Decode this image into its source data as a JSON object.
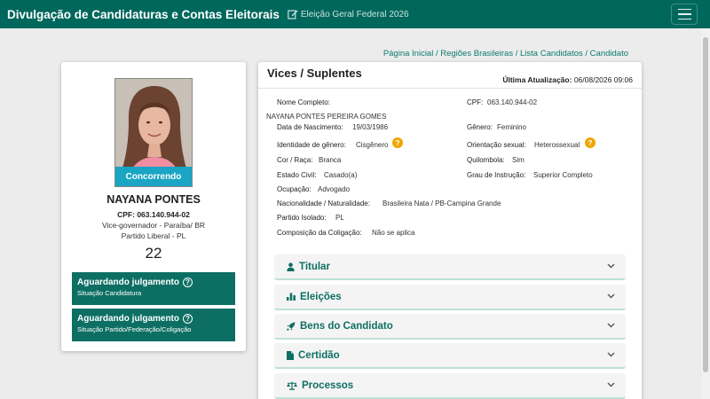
{
  "header": {
    "app_title": "Divulgação de Candidaturas e Contas Eleitorais",
    "election": "Eleição Geral Federal 2026",
    "icons": {
      "edit": "edit-icon",
      "menu": "hamburger-menu-icon"
    }
  },
  "breadcrumb": "Página Inicial / Regiões Brasileiras / Lista Candidatos / Candidato",
  "candidate": {
    "photo_status": "Concorrendo",
    "name": "NAYANA PONTES",
    "cpf": "CPF: 063.140.944-02",
    "office": "Vice-governador - Paraíba/ BR",
    "party": "Partido Liberal - PL",
    "number": "22",
    "statuses": [
      {
        "title": "Aguardando julgamento",
        "subtitle": "Situação Candidatura"
      },
      {
        "title": "Aguardando julgamento",
        "subtitle": "Situação Partido/Federação/Coligação"
      }
    ]
  },
  "details": {
    "section_title": "Vices / Suplentes",
    "last_update_label": "Última Atualização:",
    "last_update_value": "06/08/2026 09:06",
    "nome_completo_label": "Nome Completo:",
    "nome_completo_value": "NAYANA PONTES PEREIRA GOMES",
    "cpf_label": "CPF:",
    "cpf_value": "063.140.944-02",
    "nascimento_label": "Data de Nascimento:",
    "nascimento_value": "19/03/1986",
    "genero_label": "Gênero:",
    "genero_value": "Feminino",
    "identidade_label": "Identidade de gênero:",
    "identidade_value": "Cisgênero",
    "orientacao_label": "Orientação sexual:",
    "orientacao_value": "Heterossexual",
    "cor_label": "Cor / Raça:",
    "cor_value": "Branca",
    "quilombola_label": "Quilombola:",
    "quilombola_value": "Sim",
    "estado_civil_label": "Estado Civil:",
    "estado_civil_value": "Casado(a)",
    "instrucao_label": "Grau de Instrução:",
    "instrucao_value": "Superior Completo",
    "ocupacao_label": "Ocupação:",
    "ocupacao_value": "Advogado",
    "nacionalidade_label": "Nacionalidade / Naturalidade:",
    "nacionalidade_value": "Brasileira Nata / PB-Campina Grande",
    "partido_label": "Partido Isolado:",
    "partido_value": "PL",
    "coligacao_label": "Composição da Coligação:",
    "coligacao_value": "Não se aplica",
    "help_glyph": "?"
  },
  "accordion": [
    {
      "label": "Titular",
      "icon": "user-icon"
    },
    {
      "label": "Eleições",
      "icon": "bar-chart-icon"
    },
    {
      "label": "Bens do Candidato",
      "icon": "rocket-icon"
    },
    {
      "label": "Certidão",
      "icon": "document-icon"
    },
    {
      "label": "Processos",
      "icon": "scales-icon"
    }
  ],
  "colors": {
    "brand": "#00675c",
    "status_box": "#0d6f63",
    "photo_status": "#1aa5c4",
    "help_badge": "#f0a500"
  }
}
